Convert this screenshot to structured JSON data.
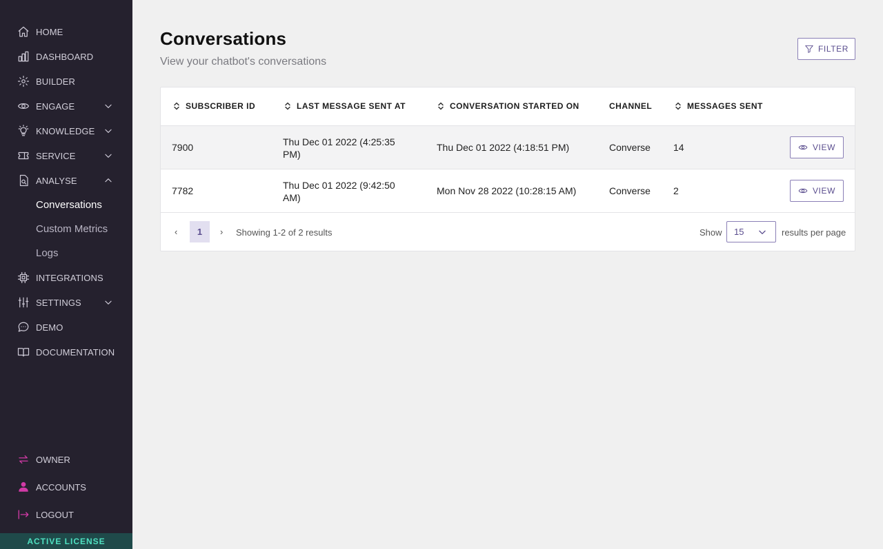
{
  "sidebar": {
    "nav": [
      {
        "label": "HOME",
        "icon": "home-icon"
      },
      {
        "label": "DASHBOARD",
        "icon": "bar-chart-icon"
      },
      {
        "label": "BUILDER",
        "icon": "builder-icon"
      },
      {
        "label": "ENGAGE",
        "icon": "eye-icon",
        "chevron": "down"
      },
      {
        "label": "KNOWLEDGE",
        "icon": "lightbulb-icon",
        "chevron": "down"
      },
      {
        "label": "SERVICE",
        "icon": "ticket-icon",
        "chevron": "down"
      },
      {
        "label": "ANALYSE",
        "icon": "analyse-icon",
        "chevron": "up"
      }
    ],
    "analyse_sub": [
      {
        "label": "Conversations",
        "active": true
      },
      {
        "label": "Custom Metrics"
      },
      {
        "label": "Logs"
      }
    ],
    "nav2": [
      {
        "label": "INTEGRATIONS",
        "icon": "chip-icon"
      },
      {
        "label": "SETTINGS",
        "icon": "sliders-icon",
        "chevron": "down"
      },
      {
        "label": "DEMO",
        "icon": "chat-bubble-icon"
      },
      {
        "label": "DOCUMENTATION",
        "icon": "book-icon"
      }
    ],
    "bottom": [
      {
        "label": "OWNER",
        "icon": "swap-arrows-icon"
      },
      {
        "label": "ACCOUNTS",
        "icon": "user-icon"
      },
      {
        "label": "LOGOUT",
        "icon": "logout-icon"
      }
    ],
    "license": "ACTIVE LICENSE"
  },
  "page": {
    "title": "Conversations",
    "subtitle": "View your chatbot's conversations",
    "filter_label": "FILTER"
  },
  "table": {
    "headers": [
      "SUBSCRIBER ID",
      "LAST MESSAGE SENT AT",
      "CONVERSATION STARTED ON",
      "CHANNEL",
      "MESSAGES SENT"
    ],
    "rows": [
      {
        "subscriber_id": "7900",
        "last_message": "Thu Dec 01 2022 (4:25:35 PM)",
        "started_on": "Thu Dec 01 2022 (4:18:51 PM)",
        "channel": "Converse",
        "messages_sent": "14",
        "action": "VIEW"
      },
      {
        "subscriber_id": "7782",
        "last_message": "Thu Dec 01 2022 (9:42:50 AM)",
        "started_on": "Mon Nov 28 2022 (10:28:15 AM)",
        "channel": "Converse",
        "messages_sent": "2",
        "action": "VIEW"
      }
    ]
  },
  "pagination": {
    "prev": "‹",
    "page": "1",
    "next": "›",
    "info": "Showing 1-2 of 2 results",
    "show_label": "Show",
    "per_page": "15",
    "per_page_label": "results per page"
  },
  "colors": {
    "sidebar_bg": "#25212e",
    "accent": "#5a4d8e",
    "license_text": "#4fe0c1",
    "bottom_icon": "#d13aa6"
  }
}
